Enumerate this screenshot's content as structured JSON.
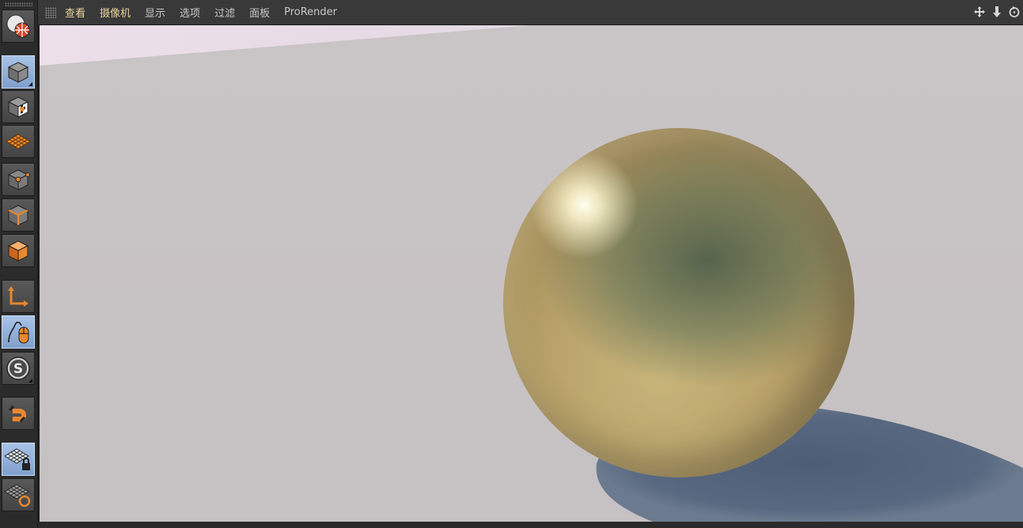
{
  "menubar": {
    "items": [
      "查看",
      "摄像机",
      "显示",
      "选项",
      "过滤",
      "面板",
      "ProRender"
    ],
    "highlight_color": "#e8d49a",
    "text_color": "#c9c9c9",
    "nav_icons": [
      "move-view-icon",
      "zoom-view-icon",
      "rotate-view-icon"
    ]
  },
  "toolbar": {
    "tools": [
      {
        "name": "undo-view-tool",
        "icon": "globe-icon",
        "active": false
      },
      {
        "name": "model-mode-tool",
        "icon": "cube-icon",
        "active": true
      },
      {
        "name": "texture-mode-tool",
        "icon": "checker-cube-icon",
        "active": false
      },
      {
        "name": "workplane-tool",
        "icon": "grid-plane-icon",
        "active": false
      },
      {
        "name": "points-mode-tool",
        "icon": "cube-points-icon",
        "active": false
      },
      {
        "name": "edges-mode-tool",
        "icon": "cube-edges-icon",
        "active": false
      },
      {
        "name": "polygons-mode-tool",
        "icon": "cube-polygons-icon",
        "active": false
      },
      {
        "name": "axis-mode-tool",
        "icon": "axis-icon",
        "active": false
      },
      {
        "name": "tweak-mode-tool",
        "icon": "mouse-icon",
        "active": true
      },
      {
        "name": "solo-tool",
        "icon": "solo-s-icon",
        "active": false
      },
      {
        "name": "snap-tool",
        "icon": "magnet-icon",
        "active": false
      },
      {
        "name": "workplane-lock-tool",
        "icon": "grid-lock-icon",
        "active": true
      },
      {
        "name": "workplane-axis-tool",
        "icon": "grid-rotate-icon",
        "active": false
      }
    ],
    "active_color": "#9ab7df",
    "accent_color": "#e8872e"
  },
  "viewport": {
    "floor_color": "#c7c2c4",
    "sky_color": "#e9dde6",
    "sphere_color": "#b9a36a",
    "shadow_color": "#55657d"
  }
}
